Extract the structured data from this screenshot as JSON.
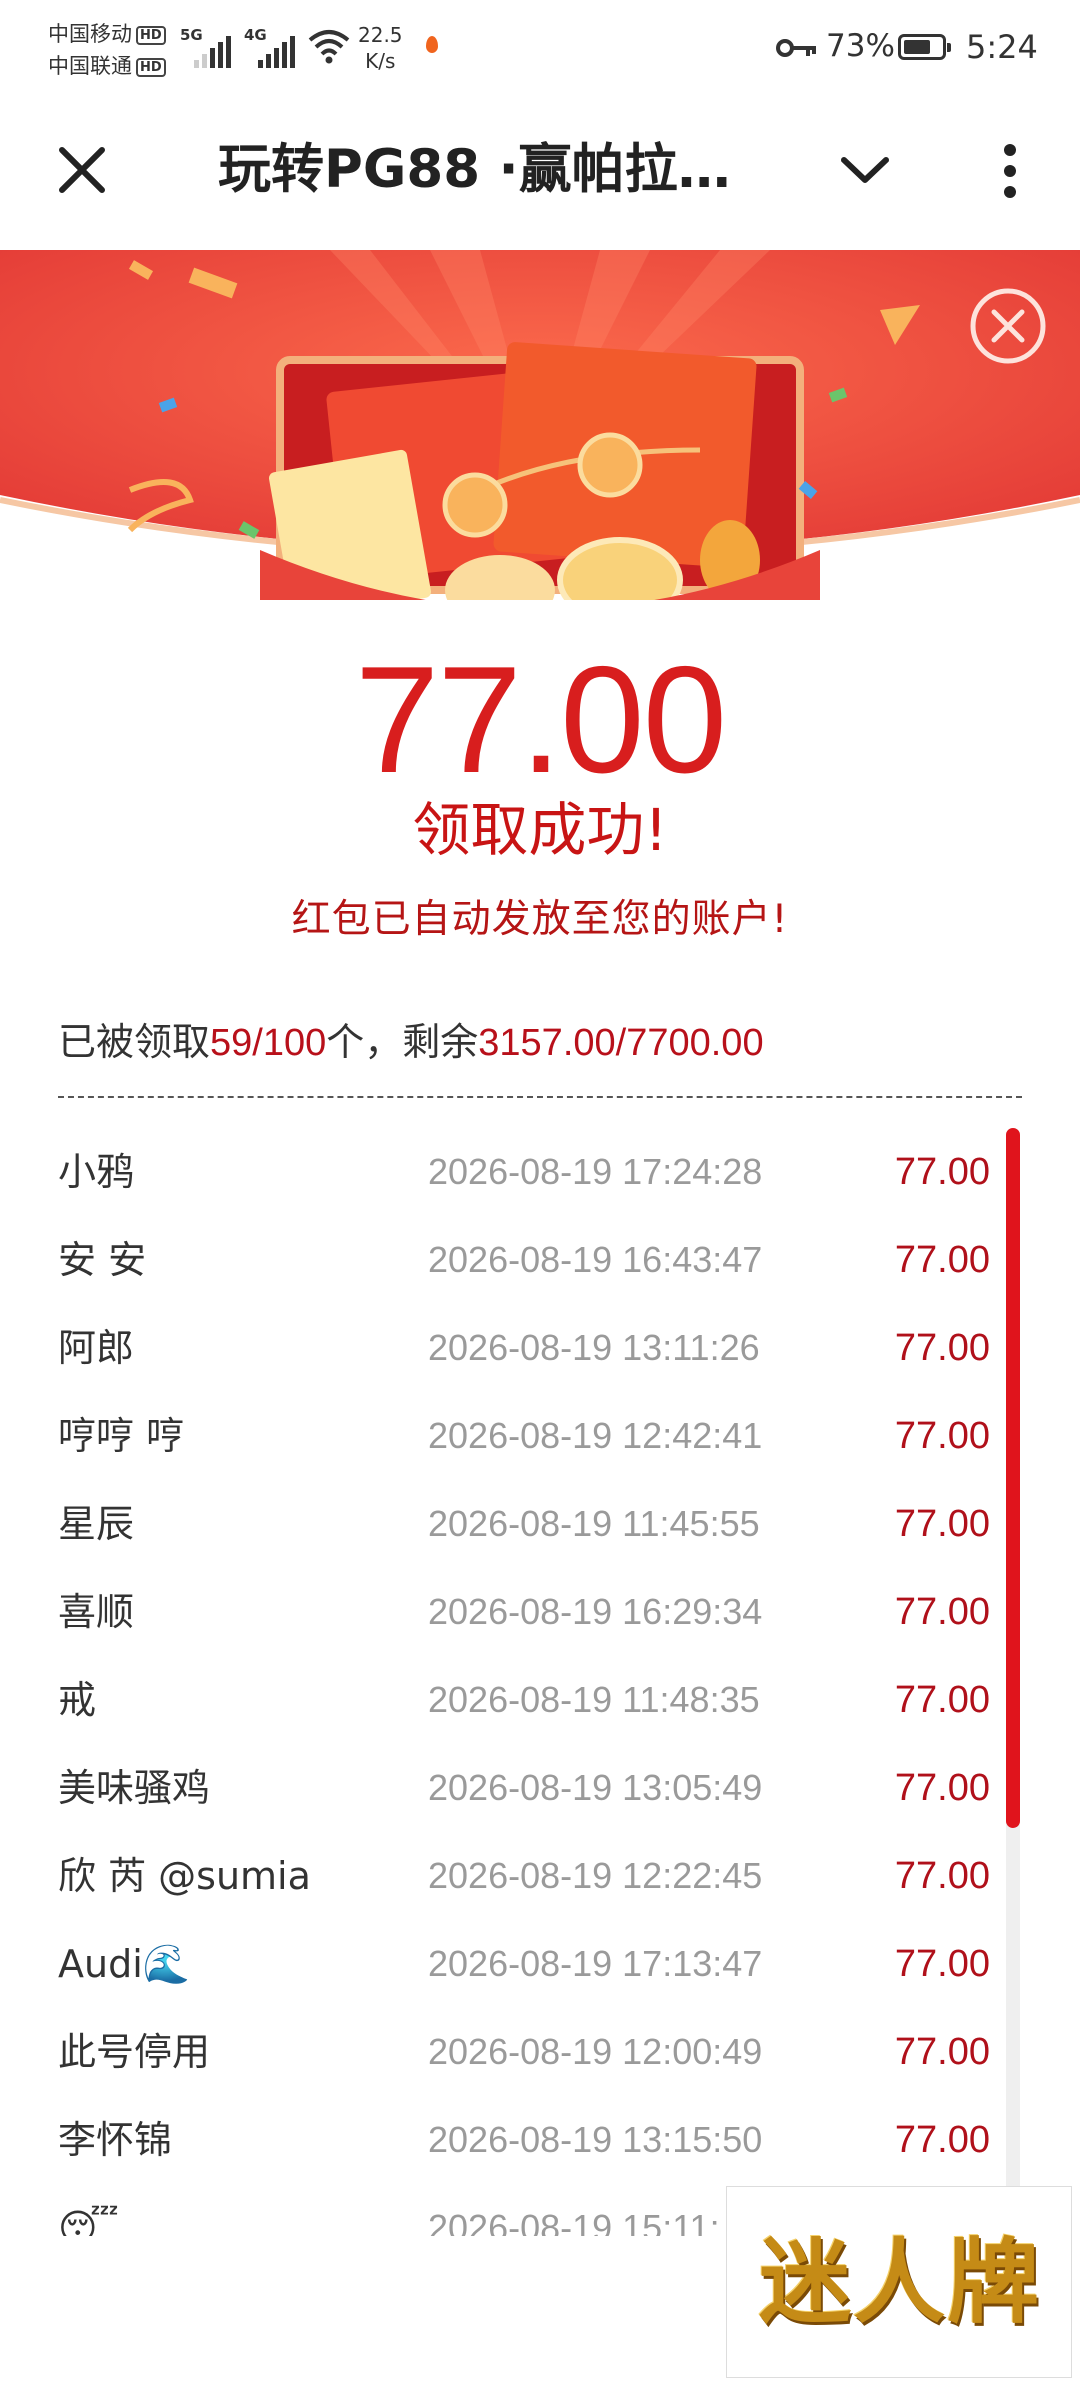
{
  "status_bar": {
    "carrier_1": "中国移动",
    "carrier_2": "中国联通",
    "hd_label": "HD",
    "network_1": "5G",
    "network_2": "4G",
    "speed_value": "22.5",
    "speed_unit": "K/s",
    "battery_percent": "73%",
    "battery_level": 0.73,
    "time": "5:24"
  },
  "nav": {
    "title": "玩转PG88 ·赢帕拉…"
  },
  "result": {
    "amount": "77.00",
    "success_text": "领取成功!",
    "auto_note": "红包已自动发放至您的账户!"
  },
  "summary": {
    "prefix": "已被领取",
    "claimed": "59",
    "slash_1": "/",
    "total_count": "100",
    "middle": "个，剩余",
    "remaining": "3157.00",
    "slash_2": "/",
    "total_amount": "7700.00"
  },
  "claims": [
    {
      "name": "小鸦",
      "time": "2026-08-19 17:24:28",
      "amount": "77.00"
    },
    {
      "name": "安 安",
      "time": "2026-08-19 16:43:47",
      "amount": "77.00"
    },
    {
      "name": "阿郎",
      "time": "2026-08-19 13:11:26",
      "amount": "77.00"
    },
    {
      "name": "哼哼 哼",
      "time": "2026-08-19 12:42:41",
      "amount": "77.00"
    },
    {
      "name": "星辰",
      "time": "2026-08-19 11:45:55",
      "amount": "77.00"
    },
    {
      "name": "喜顺",
      "time": "2026-08-19 16:29:34",
      "amount": "77.00"
    },
    {
      "name": "戒",
      "time": "2026-08-19 11:48:35",
      "amount": "77.00"
    },
    {
      "name": "美味骚鸡",
      "time": "2026-08-19 13:05:49",
      "amount": "77.00"
    },
    {
      "name": "欣 芮 @sumia",
      "time": "2026-08-19 12:22:45",
      "amount": "77.00"
    },
    {
      "name": "Audi🌊",
      "time": "2026-08-19 17:13:47",
      "amount": "77.00"
    },
    {
      "name": "此号停用",
      "time": "2026-08-19 12:00:49",
      "amount": "77.00"
    },
    {
      "name": "李怀锦",
      "time": "2026-08-19 13:15:50",
      "amount": "77.00"
    },
    {
      "name": "😴",
      "time": "2026-08-19 15:11:",
      "amount": ""
    }
  ],
  "logo": {
    "text": "迷人牌"
  },
  "colors": {
    "accent_red": "#d81e1e",
    "amount_red": "#b0101a",
    "banner_red": "#e8443a",
    "scroll_thumb": "#e0141c"
  },
  "icons": {
    "close": "close-icon",
    "chevron": "chevron-down-icon",
    "more": "more-vertical-icon",
    "banner_close": "circle-close-icon"
  }
}
